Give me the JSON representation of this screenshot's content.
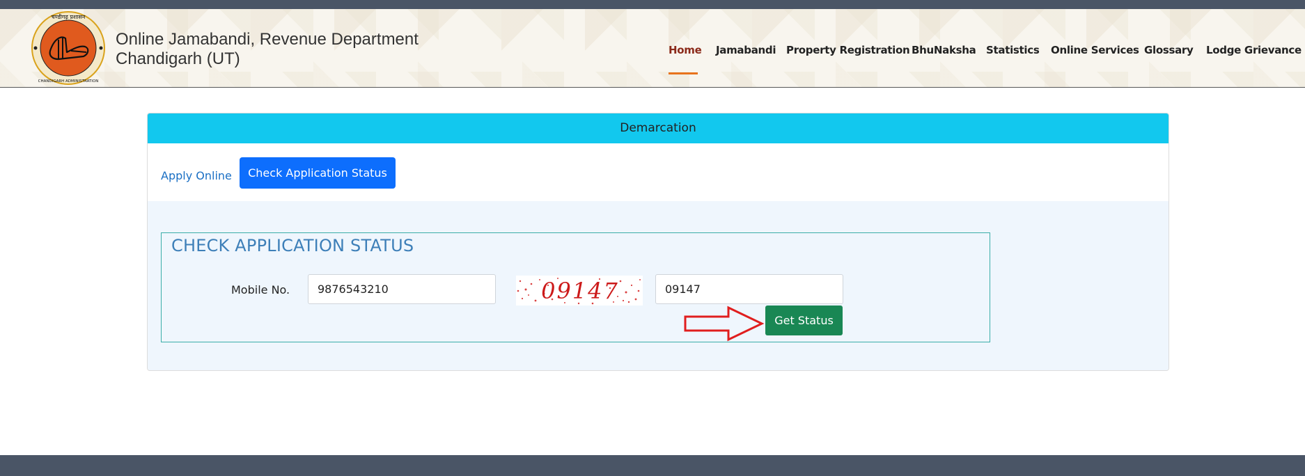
{
  "header": {
    "logo_text_top": "चण्डीगढ़ प्रशासन",
    "logo_text_bottom": "CHANDIGARH ADMINISTRATION",
    "title_line1": "Online Jamabandi, Revenue Department",
    "title_line2": "Chandigarh (UT)"
  },
  "nav": {
    "items": [
      {
        "label": "Home"
      },
      {
        "label": "Jamabandi"
      },
      {
        "label": "Property Registration"
      },
      {
        "label": "BhuNaksha"
      },
      {
        "label": "Statistics"
      },
      {
        "label": "Online Services"
      },
      {
        "label": "Glossary"
      },
      {
        "label": "Lodge Grievance"
      }
    ],
    "active_index": 0
  },
  "panel": {
    "heading": "Demarcation",
    "tabs": {
      "apply_online": "Apply Online",
      "check_status": "Check Application Status"
    },
    "form": {
      "title": "CHECK APPLICATION STATUS",
      "mobile_label": "Mobile No.",
      "mobile_value": "9876543210",
      "captcha_image_text": "09147",
      "captcha_value": "09147",
      "submit_label": "Get Status"
    }
  },
  "colors": {
    "panel_header": "#12c8ee",
    "primary_button": "#0d6efd",
    "success_button": "#198754",
    "nav_active": "#8b2a1a",
    "nav_underline": "#e8731c",
    "annotation_arrow": "#e01e1e"
  }
}
